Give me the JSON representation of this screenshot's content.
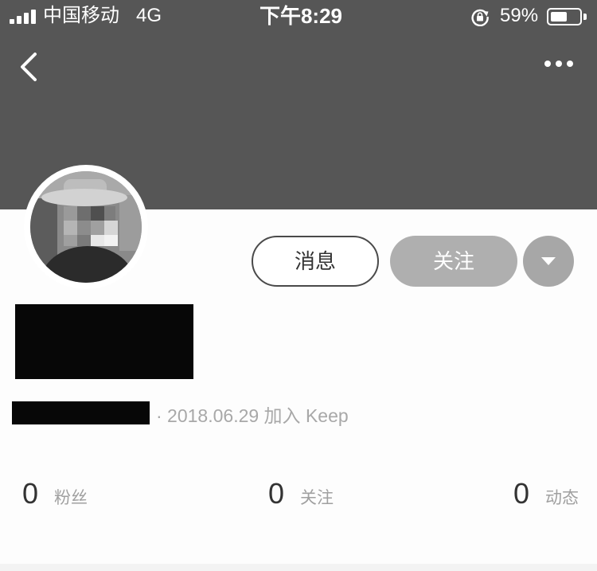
{
  "status_bar": {
    "carrier": "中国移动",
    "network": "4G",
    "time": "下午8:29",
    "battery_percent": "59%",
    "battery_level": 0.59,
    "signal_bars": 4
  },
  "icons": {
    "back": "chevron-left-icon",
    "more": "more-horizontal-icon",
    "signal": "signal-icon",
    "rotation_lock": "rotation-lock-icon",
    "battery": "battery-icon",
    "dropdown": "caret-down-icon"
  },
  "profile": {
    "actions": {
      "message_label": "消息",
      "follow_label": "关注"
    },
    "join_info": "· 2018.06.29 加入 Keep"
  },
  "stats": [
    {
      "value": "0",
      "label": "粉丝"
    },
    {
      "value": "0",
      "label": "关注"
    },
    {
      "value": "0",
      "label": "动态"
    }
  ],
  "colors": {
    "header_bg": "#565656",
    "follow_button_bg": "#afafaf",
    "dropdown_button_bg": "#a7a7a7",
    "join_text": "#a8a8a8"
  }
}
